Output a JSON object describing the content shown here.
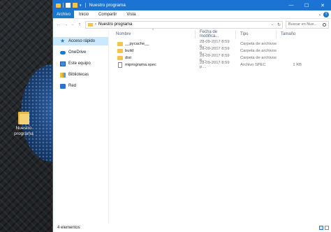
{
  "desktop": {
    "icon_label": "Nuestro programa"
  },
  "window": {
    "title": "Nuestro programa",
    "controls": {
      "minimize": "—",
      "maximize": "☐",
      "close": "✕"
    }
  },
  "ribbon": {
    "file_tab": "Archivo",
    "tabs": [
      "Inicio",
      "Compartir",
      "Vista"
    ],
    "expand_glyph": "⌄",
    "help_glyph": "?"
  },
  "address_bar": {
    "back_glyph": "←",
    "forward_glyph": "→",
    "recent_glyph": "⌄",
    "up_glyph": "↑",
    "separator": "›",
    "path": "Nuestro programa",
    "dropdown_glyph": "⌄",
    "refresh_glyph": "↻"
  },
  "search": {
    "placeholder": "Buscar en Nue..."
  },
  "navigation": {
    "items": [
      {
        "label": "Acceso rápido",
        "icon": "star-icon",
        "selected": true
      },
      {
        "label": "OneDrive",
        "icon": "cloud-icon",
        "selected": false
      },
      {
        "label": "Este equipo",
        "icon": "computer-icon",
        "selected": false
      },
      {
        "label": "Bibliotecas",
        "icon": "libraries-icon",
        "selected": false
      },
      {
        "label": "Red",
        "icon": "network-icon",
        "selected": false
      }
    ]
  },
  "file_list": {
    "columns": {
      "name": "Nombre",
      "date": "Fecha de modifica...",
      "type": "Tipo",
      "size": "Tamaño"
    },
    "sort_glyph": "^",
    "rows": [
      {
        "name": "__pycache__",
        "date": "28-09-2017 8:59 p....",
        "type": "Carpeta de archivos",
        "size": "",
        "kind": "folder"
      },
      {
        "name": "build",
        "date": "28-09-2017 8:59 p....",
        "type": "Carpeta de archivos",
        "size": "",
        "kind": "folder"
      },
      {
        "name": "dist",
        "date": "28-09-2017 8:59 p....",
        "type": "Carpeta de archivos",
        "size": "",
        "kind": "folder"
      },
      {
        "name": "miprograma.spec",
        "date": "28-09-2017 8:59 p....",
        "type": "Archivo SPEC",
        "size": "1 KB",
        "kind": "file"
      }
    ]
  },
  "status_bar": {
    "item_count": "4 elementos"
  }
}
